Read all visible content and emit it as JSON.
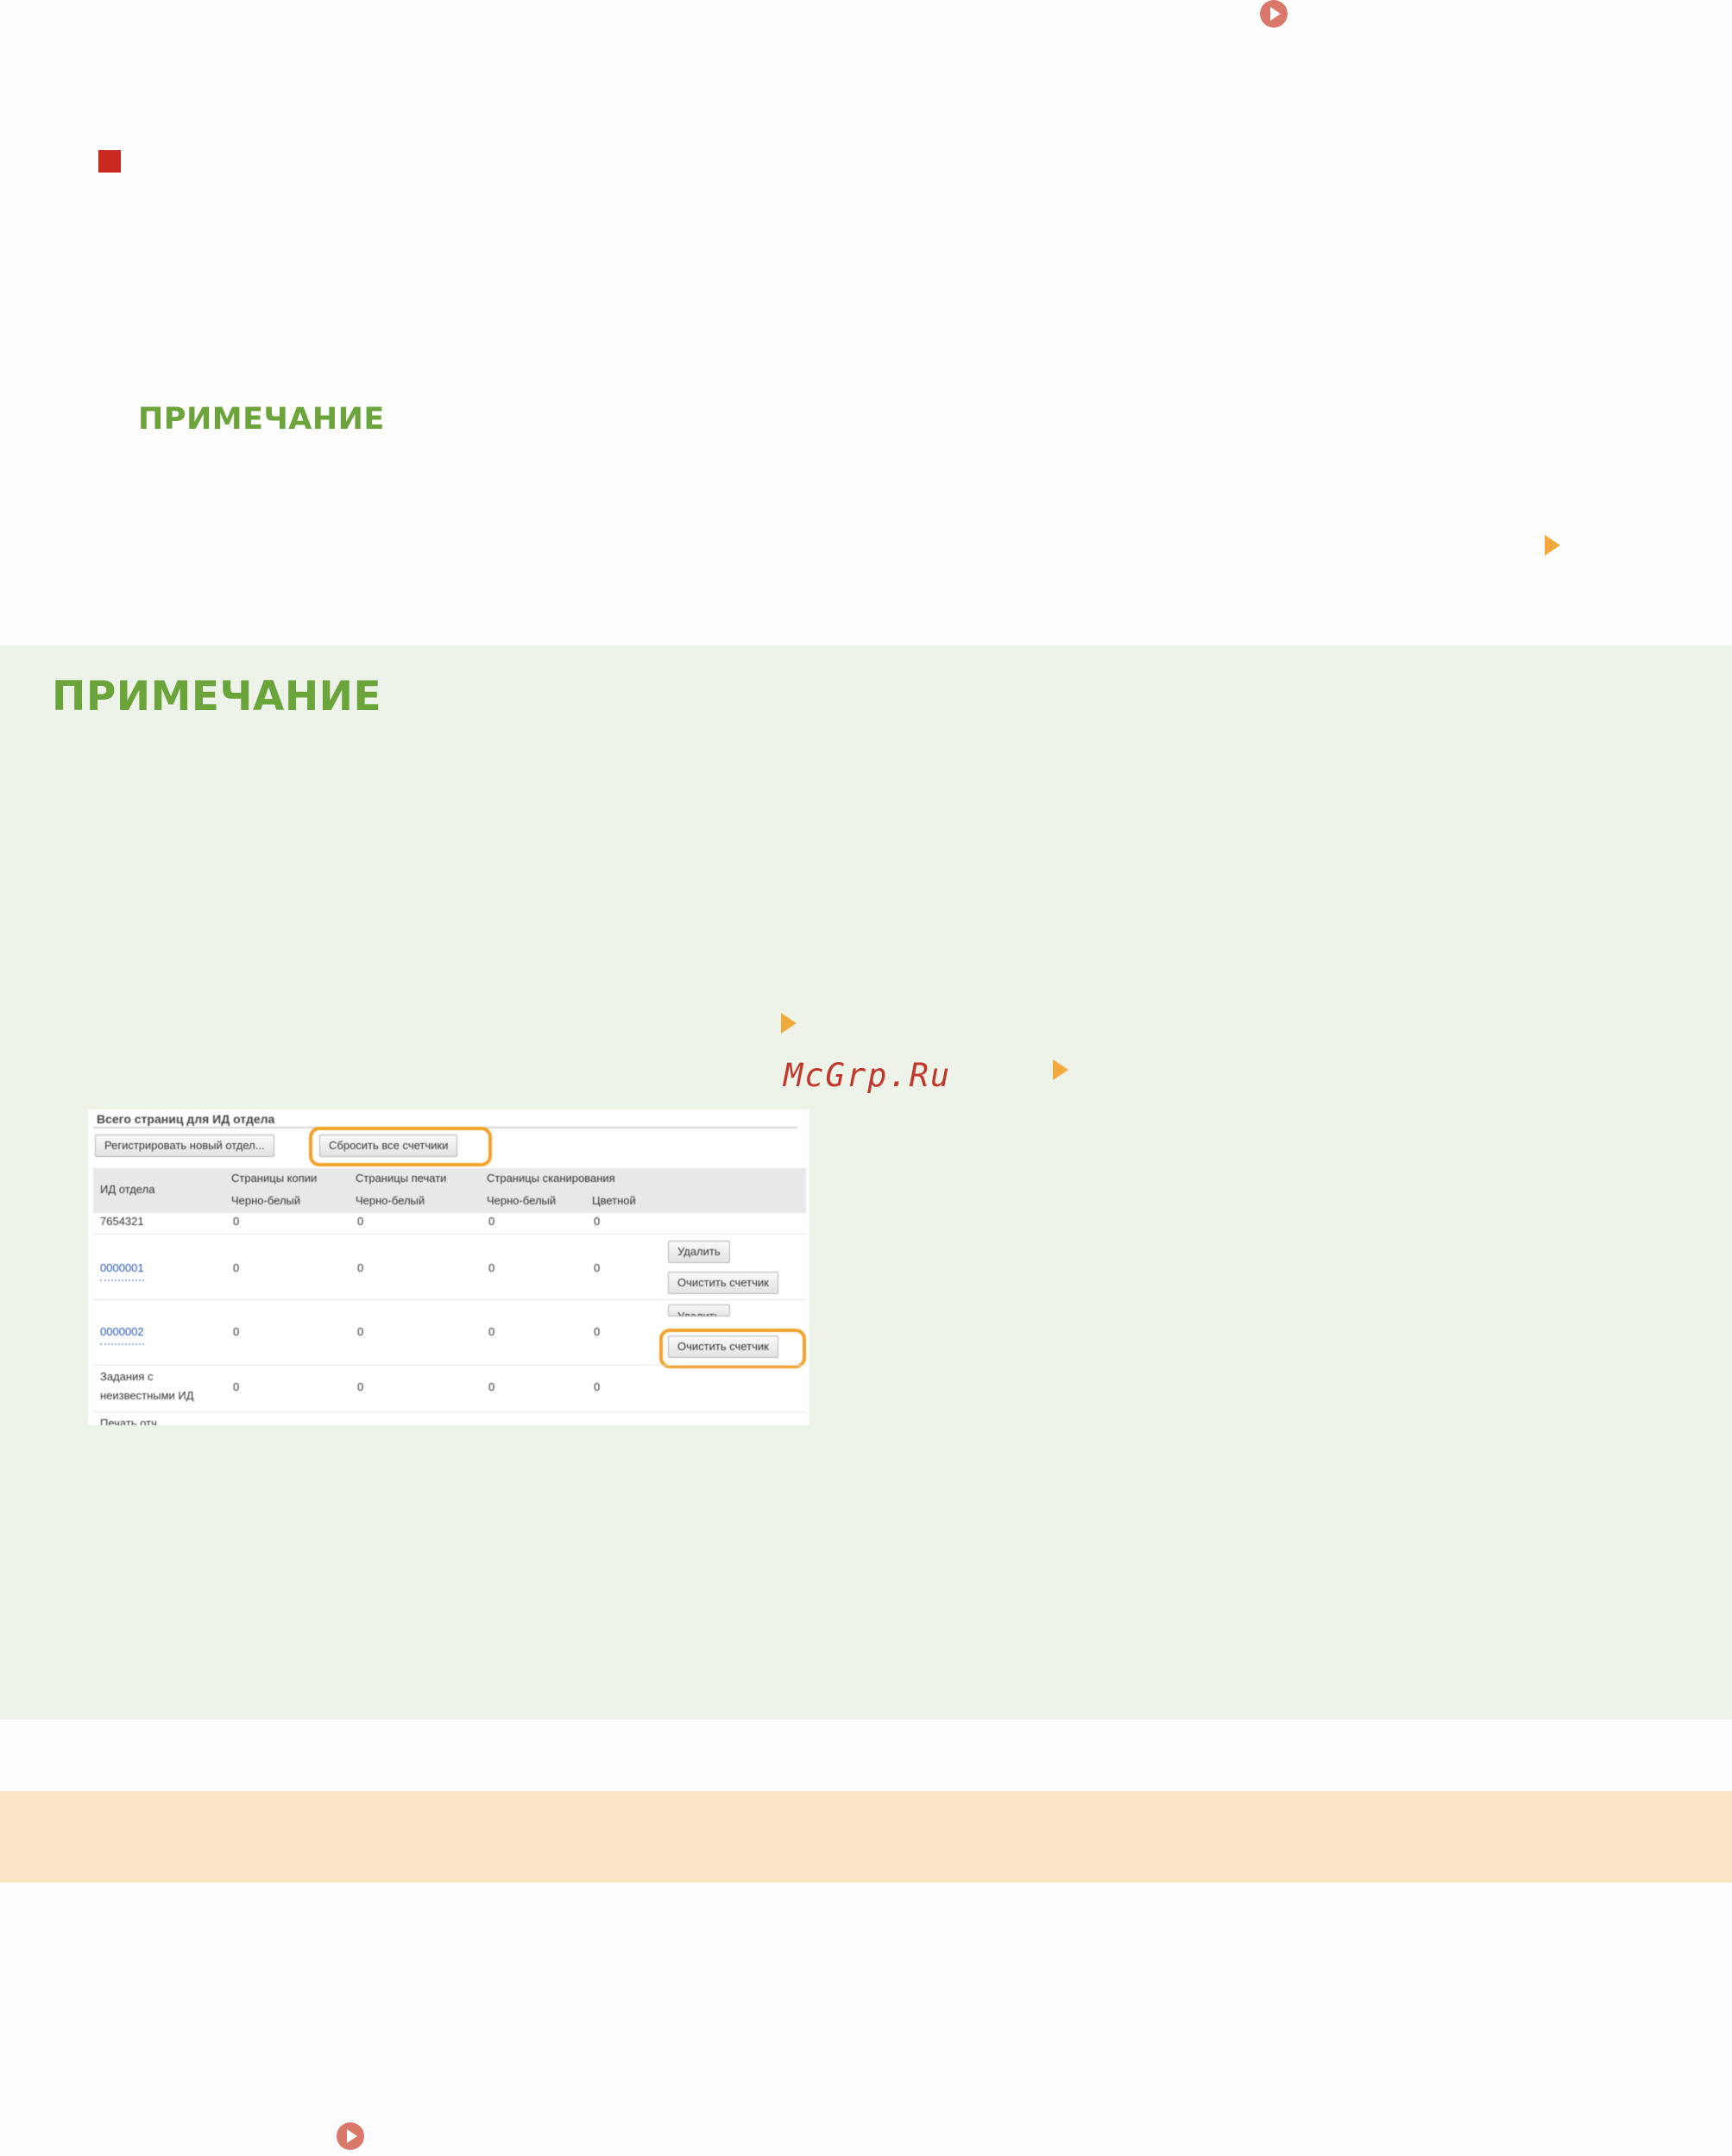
{
  "note_heading_1": "ПРИМЕЧАНИЕ",
  "note_heading_2": "ПРИМЕЧАНИЕ",
  "watermark": "McGrp.Ru",
  "screenshot": {
    "title": "Всего страниц для ИД отдела",
    "register_button": "Регистрировать новый отдел...",
    "reset_all_button": "Сбросить все счетчики",
    "headers": {
      "dept_id": "ИД отдела",
      "copy_pages": "Страницы копии",
      "print_pages": "Страницы печати",
      "scan_pages": "Страницы сканирования",
      "bw_copy": "Черно-белый",
      "bw_print": "Черно-белый",
      "bw_scan": "Черно-белый",
      "color_scan": "Цветной"
    },
    "rows": [
      {
        "id": "7654321",
        "copy_bw": "0",
        "print_bw": "0",
        "scan_bw": "0",
        "scan_color": "0"
      },
      {
        "id": "0000001",
        "copy_bw": "0",
        "print_bw": "0",
        "scan_bw": "0",
        "scan_color": "0",
        "delete": "Удалить",
        "clear": "Очистить счетчик"
      },
      {
        "id": "0000002",
        "copy_bw": "0",
        "print_bw": "0",
        "scan_bw": "0",
        "scan_color": "0",
        "delete": "Удалить",
        "clear": "Очистить счетчик"
      },
      {
        "id_line1": "Задания с",
        "id_line2": "неизвестными ИД",
        "copy_bw": "0",
        "print_bw": "0",
        "scan_bw": "0",
        "scan_color": "0"
      }
    ],
    "cut_row_text": "Печать отч"
  },
  "icons": {
    "link_icon": "circle-play-icon",
    "arrow_icon": "orange-triangle-icon",
    "bullet_icon": "red-square-icon"
  },
  "colors": {
    "note_green": "#6aa43a",
    "note_panel": "#edf3e8",
    "accent_orange": "#f2a93b",
    "bullet_red": "#c8281e",
    "info_bar": "#fbe4c6"
  }
}
